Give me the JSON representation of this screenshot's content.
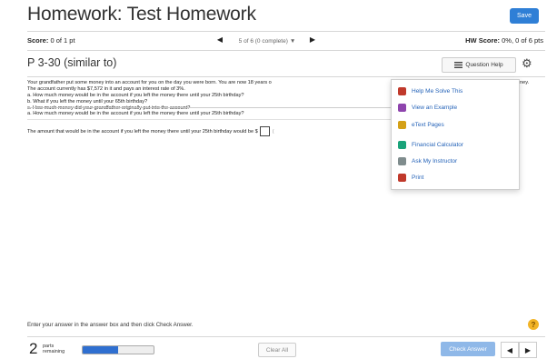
{
  "header": {
    "title": "Homework: Test Homework",
    "save_label": "Save"
  },
  "scorebar": {
    "score_label": "Score:",
    "score_value": "0 of 1 pt",
    "question_nav": "5 of 6 (0 complete)",
    "hw_score_label": "HW Score:",
    "hw_score_value": "0%, 0 of 6 pts"
  },
  "question": {
    "title": "P 3-30 (similar to)",
    "help_label": "Question Help",
    "problem_lines": [
      "Your grandfather put some money into an account for you on the day you were born. You are now 18 years o",
      "The account currently has $7,572 in it and pays an interest rate of 3%.",
      "a. How much money would be in the account if you left the money there until your 25th birthday?",
      "b. What if you left the money until your 65th birthday?",
      "c. How much money did your grandfather originally put into the account?"
    ],
    "problem_line_tail": "ney.",
    "sub_question": "a. How much money would be in the account if you left the money there until your 25th birthday?",
    "answer_prompt": "The amount that would be in the account if you left the money there until your 25th birthday would be $",
    "answer_value": "",
    "answer_tail": "(",
    "instruction": "Enter your answer in the answer box and then click Check Answer."
  },
  "help_menu": {
    "items": [
      {
        "label": "Help Me Solve This",
        "icon": "help-solve-icon",
        "color": "#c0392b"
      },
      {
        "label": "View an Example",
        "icon": "example-icon",
        "color": "#8e44ad"
      },
      {
        "label": "eText Pages",
        "icon": "book-icon",
        "color": "#d4a017"
      },
      {
        "label": "Financial Calculator",
        "icon": "calculator-icon",
        "color": "#1aa37a"
      },
      {
        "label": "Ask My Instructor",
        "icon": "instructor-icon",
        "color": "#7f8c8d"
      },
      {
        "label": "Print",
        "icon": "printer-icon",
        "color": "#c0392b"
      }
    ]
  },
  "footer": {
    "parts_count": "2",
    "parts_label_1": "parts",
    "parts_label_2": "remaining",
    "progress_fraction": 0.5,
    "clear_label": "Clear All",
    "check_label": "Check Answer"
  },
  "colors": {
    "accent": "#2f7fd6",
    "progress": "#2f6fd0",
    "link": "#2563b8"
  }
}
